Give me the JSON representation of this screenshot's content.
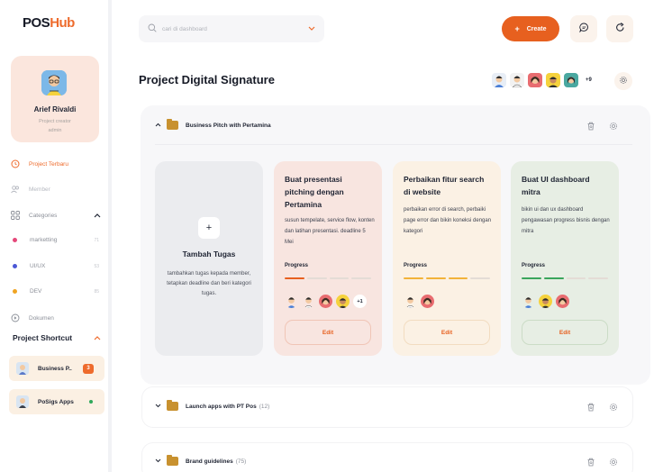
{
  "app": {
    "logo_a": "POS",
    "logo_b": "Hub"
  },
  "profile": {
    "name": "Arief Rivaldi",
    "role_line1": "Project creator",
    "role_line2": "admin"
  },
  "nav": {
    "project_terbaru": "Project Terbaru",
    "member": "Member",
    "categories": "Categories",
    "dokumen": "Dokumen"
  },
  "categories": [
    {
      "label": "marketting",
      "count": "71",
      "color": "#e5487a"
    },
    {
      "label": "UI/UX",
      "count": "53",
      "color": "#4b58d6"
    },
    {
      "label": "DEV",
      "count": "85",
      "color": "#f0a422"
    }
  ],
  "shortcut": {
    "title": "Project Shortcut",
    "items": [
      {
        "label": "Business P..",
        "badge": "3"
      },
      {
        "label": "PoSigs Apps"
      }
    ]
  },
  "search": {
    "placeholder": "cari di dashboard"
  },
  "header": {
    "create_label": "Create",
    "page_title": "Project Digital Signature",
    "more_members": "+9"
  },
  "groups": [
    {
      "name": "Business Pitch with Pertamina",
      "count": ""
    },
    {
      "name": "Launch apps with PT Pos",
      "count": "(12)"
    },
    {
      "name": "Brand guidelines",
      "count": "(75)"
    }
  ],
  "add_card": {
    "plus": "+",
    "title": "Tambah Tugas",
    "desc": "tambahkan tugas kepada member, tetapkan deadline dan beri kategori tugas."
  },
  "tasks": [
    {
      "title": "Buat presentasi pitching dengan Pertamina",
      "desc": "susun tempelate, service flow, konten dan latihan presentasi. deadline 5 Mei",
      "progress_label": "Progress",
      "progress": 0.25,
      "extra": "+1",
      "edit": "Edit",
      "bg": "#f8e5e0",
      "accent": "#e7601f"
    },
    {
      "title": "Perbaikan fitur search di website",
      "desc": "perbaikan error di search, perbaiki page error dan bikin koneksi dengan kategori",
      "progress_label": "Progress",
      "progress": 0.75,
      "edit": "Edit",
      "bg": "#fbf1e4",
      "accent": "#f2b33a"
    },
    {
      "title": "Buat UI dashboard mitra",
      "desc": "bikin ui dan ux dashboard pengawasan progress bisnis dengan mitra",
      "progress_label": "Progress",
      "progress": 0.5,
      "edit": "Edit",
      "bg": "#e7eee4",
      "accent": "#3aa55c"
    }
  ],
  "colors": {
    "accent": "#e7601f",
    "brand_dark": "#161a26"
  },
  "icons": [
    "search-icon",
    "chevron-down-icon",
    "plus-icon",
    "chat-icon",
    "refresh-icon",
    "gear-icon",
    "trash-icon",
    "folder-icon",
    "clock-icon",
    "people-icon",
    "grid-icon",
    "document-icon"
  ]
}
